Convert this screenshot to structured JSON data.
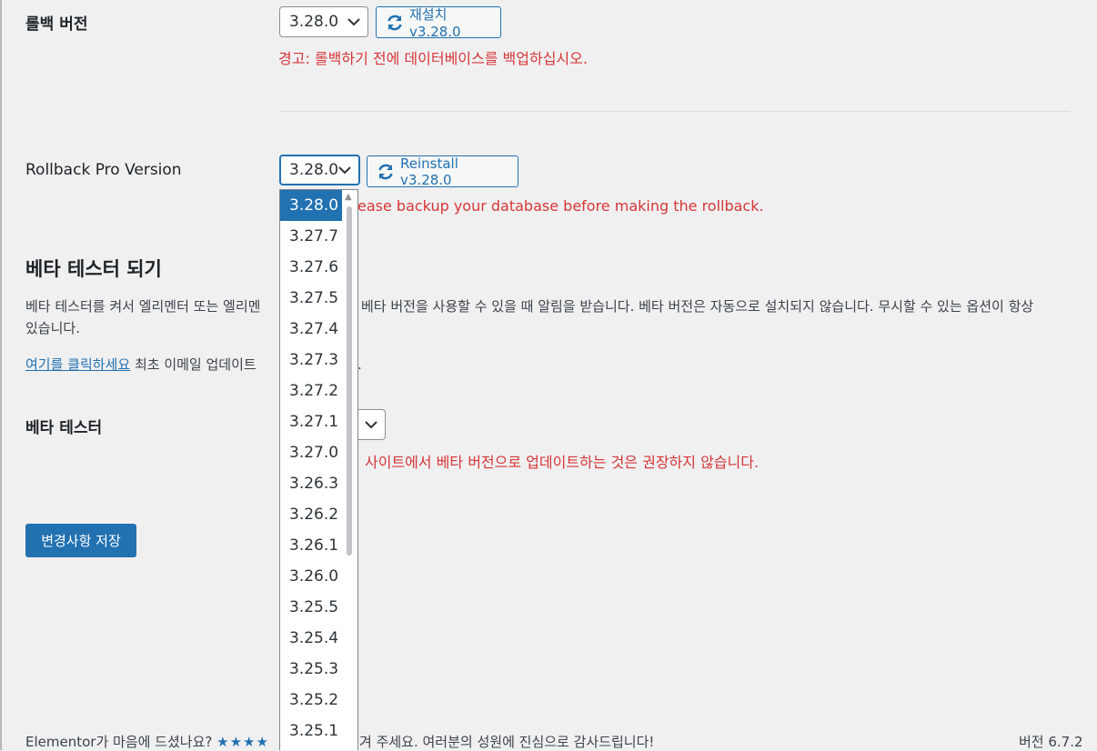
{
  "rollback": {
    "label": "롤백 버전",
    "selected": "3.28.0",
    "button": "재설치 v3.28.0",
    "warning": "경고: 롤백하기 전에 데이터베이스를 백업하십시오."
  },
  "rollback_pro": {
    "label": "Rollback Pro Version",
    "selected": "3.28.0",
    "button": "Reinstall v3.28.0",
    "warning_visible": "ease backup your database before making the rollback."
  },
  "beta": {
    "heading": "베타 테스터 되기",
    "desc_line1_a": "베타 테스터를 켜서 엘리멘터 또는 엘리멘",
    "desc_line1_b": "베타 버전을 사용할 수 있을 때 알림을 받습니다. 베타 버전은 자동으로 설치되지 않습니다. 무시할 수 있는 옵션이 항상",
    "desc_line2": "있습니다.",
    "link": "여기를 클릭하세요",
    "email_text": "최초 이메일 업데이트",
    "email_tail": ".",
    "tester_label": "베타 테스터",
    "warning_visible": "사이트에서 베타 버전으로 업데이트하는 것은 권장하지 않습니다."
  },
  "save_button": "변경사항 저장",
  "footer": {
    "left_a": "Elementor가 마음에 드셨나요?",
    "stars": "★★★★",
    "left_b": "겨 주세요. 여러분의 성원에 진심으로 감사드립니다!",
    "version": "버전 6.7.2"
  },
  "dropdown": {
    "options": [
      "3.28.0",
      "3.27.7",
      "3.27.6",
      "3.27.5",
      "3.27.4",
      "3.27.3",
      "3.27.2",
      "3.27.1",
      "3.27.0",
      "3.26.3",
      "3.26.2",
      "3.26.1",
      "3.26.0",
      "3.25.5",
      "3.25.4",
      "3.25.3",
      "3.25.2",
      "3.25.1"
    ],
    "selected_index": 0
  },
  "colors": {
    "accent": "#2271b1",
    "warning": "#d63638",
    "background": "#f0f0f1"
  }
}
